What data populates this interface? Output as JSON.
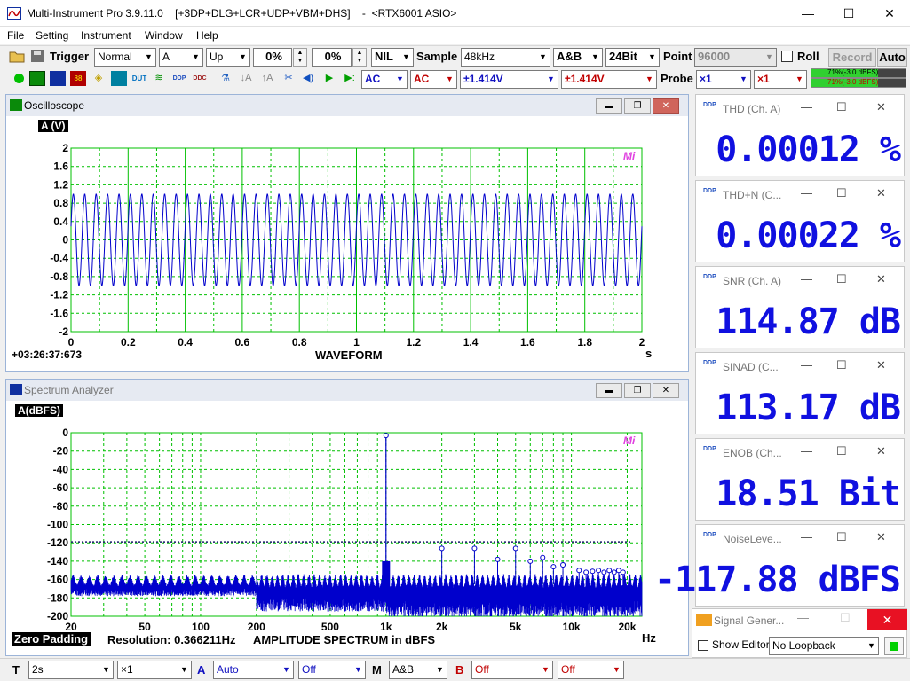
{
  "window": {
    "title": "Multi-Instrument Pro 3.9.11.0    [+3DP+DLG+LCR+UDP+VBM+DHS]    -  <RTX6001 ASIO>",
    "minimize": "—",
    "maximize": "☐",
    "close": "✕"
  },
  "menu": [
    "File",
    "Setting",
    "Instrument",
    "Window",
    "Help"
  ],
  "toolbar1": {
    "trigger_label": "Trigger",
    "trigger_mode": "Normal",
    "trigger_channel": "A",
    "trigger_edge": "Up",
    "trigger_level": "0%",
    "trigger_delay": "0%",
    "nil": "NIL",
    "sample_label": "Sample",
    "sample_rate": "48kHz",
    "channels": "A&B",
    "bits": "24Bit",
    "point_label": "Point",
    "points": "96000",
    "roll_label": "Roll",
    "record_label": "Record",
    "auto_label": "Auto",
    "level_a": "71%(-3.0 dBFS)",
    "level_b": "71%(-3.0 dBFS)"
  },
  "toolbar2": {
    "coupling_a": "AC",
    "coupling_b": "AC",
    "range_a": "±1.414V",
    "range_b": "±1.414V",
    "probe_label": "Probe",
    "probe_a": "×1",
    "probe_b": "×1"
  },
  "oscilloscope": {
    "title": "Oscilloscope",
    "unit_label": "A (V)",
    "time_readout": "+03:26:37:673",
    "caption": "WAVEFORM",
    "x_unit": "s",
    "logo": "Mi"
  },
  "spectrum": {
    "title": "Spectrum Analyzer",
    "unit_label": "A(dBFS)",
    "zero_padding": "Zero Padding",
    "resolution": "Resolution: 0.366211Hz",
    "caption": "AMPLITUDE SPECTRUM in dBFS",
    "x_unit": "Hz",
    "logo": "Mi"
  },
  "chart_data": [
    {
      "type": "line",
      "title": "WAVEFORM",
      "xlabel": "s",
      "ylabel": "A (V)",
      "xlim": [
        0,
        2
      ],
      "ylim": [
        -2,
        2
      ],
      "x_ticks": [
        0,
        0.2,
        0.4,
        0.6,
        0.8,
        1,
        1.2,
        1.4,
        1.6,
        1.8,
        2
      ],
      "y_ticks": [
        2,
        1.6,
        1.2,
        0.8,
        0.4,
        0,
        -0.4,
        -0.8,
        -1.2,
        -1.6,
        -2
      ],
      "series": [
        {
          "amplitude": 1.0,
          "approx_cycles": 50
        }
      ],
      "grid": true,
      "color": "#0000cc"
    },
    {
      "type": "line",
      "title": "AMPLITUDE SPECTRUM in dBFS",
      "xlabel": "Hz",
      "ylabel": "A(dBFS)",
      "x_scale": "log",
      "xlim": [
        20,
        24000
      ],
      "ylim": [
        -200,
        0
      ],
      "x_tick_labels": [
        "20",
        "50",
        "100",
        "200",
        "500",
        "1k",
        "2k",
        "5k",
        "10k",
        "20k"
      ],
      "x_tick_values": [
        20,
        50,
        100,
        200,
        500,
        1000,
        2000,
        5000,
        10000,
        20000
      ],
      "y_ticks": [
        0,
        -20,
        -40,
        -60,
        -80,
        -100,
        -120,
        -140,
        -160,
        -180,
        -200
      ],
      "fundamental": {
        "freq": 1000,
        "level": -3
      },
      "harmonics": [
        {
          "freq": 2000,
          "level": -126
        },
        {
          "freq": 3000,
          "level": -126
        },
        {
          "freq": 4000,
          "level": -138
        },
        {
          "freq": 5000,
          "level": -126
        },
        {
          "freq": 6000,
          "level": -140
        },
        {
          "freq": 7000,
          "level": -136
        },
        {
          "freq": 8000,
          "level": -146
        },
        {
          "freq": 9000,
          "level": -144
        },
        {
          "freq": 11000,
          "level": -150
        },
        {
          "freq": 12000,
          "level": -152
        },
        {
          "freq": 13000,
          "level": -151
        },
        {
          "freq": 14000,
          "level": -150
        },
        {
          "freq": 15000,
          "level": -152
        },
        {
          "freq": 16000,
          "level": -150
        },
        {
          "freq": 17000,
          "level": -152
        },
        {
          "freq": 18000,
          "level": -150
        },
        {
          "freq": 19000,
          "level": -152
        }
      ],
      "reference_line": -119,
      "noise_floor": [
        -160,
        -180
      ],
      "grid": true,
      "color": "#0000cc"
    }
  ],
  "meters": [
    {
      "title": "THD (Ch. A)",
      "value": "0.00012 %"
    },
    {
      "title": "THD+N (C...",
      "value": "0.00022 %"
    },
    {
      "title": "SNR (Ch. A)",
      "value": "114.87 dB"
    },
    {
      "title": "SINAD (C...",
      "value": "113.17 dB"
    },
    {
      "title": "ENOB (Ch...",
      "value": "18.51 Bit"
    },
    {
      "title": "NoiseLeve...",
      "value": "-117.88 dBFS"
    }
  ],
  "signal_generator": {
    "title": "Signal Gener...",
    "show_editor_label": "Show Editor",
    "loopback": "No Loopback"
  },
  "statusbar": {
    "t_label": "T",
    "timebase": "2s",
    "t_mult": "×1",
    "a_label": "A",
    "a_scale": "Auto",
    "a_offset": "Off",
    "m_label": "M",
    "m_mode": "A&B",
    "b_label": "B",
    "b_scale": "Off",
    "b_offset": "Off"
  },
  "colors": {
    "trace": "#0000cc",
    "grid": "#00c000",
    "meter_value": "#1010e0",
    "title_red": "#cc0000"
  }
}
